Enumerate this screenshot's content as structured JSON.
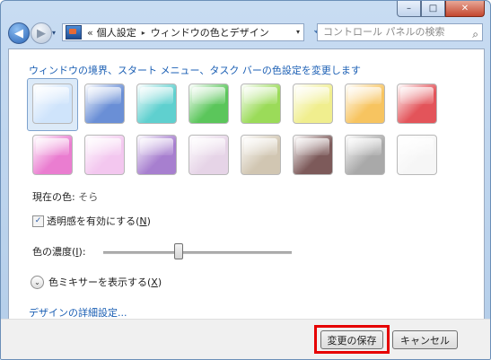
{
  "window": {
    "caption_min": "–",
    "caption_max": "□",
    "caption_close": "✕"
  },
  "nav": {
    "back_icon": "◀",
    "forward_icon": "▶",
    "history_icon": "▾",
    "address_chevron": "«",
    "crumbs": [
      "個人設定",
      "ウィンドウの色とデザイン"
    ],
    "crumb_separator": "▸",
    "address_dropdown": "▾",
    "refresh_icon": "⟲",
    "search_placeholder": "コントロール パネルの検索",
    "search_icon": "⌕"
  },
  "main": {
    "heading": "ウィンドウの境界、スタート メニュー、タスク バーの色設定を変更します",
    "swatch_colors": [
      [
        "#cfe4fb",
        "#6a8fd6",
        "#5fd0cf",
        "#5bc65b",
        "#9bdb59",
        "#f0ee8e",
        "#f7c460",
        "#e3545a"
      ],
      [
        "#ea7dd0",
        "#f3c7ef",
        "#a77fcf",
        "#e6d4e7",
        "#d1c6b2",
        "#7d5a5a",
        "#a9a9a9",
        "#f6f6f6"
      ]
    ],
    "selected_swatch": "row0-col0",
    "current_color_label": "現在の色:",
    "current_color_value": "そら",
    "transparency_check": "✓",
    "transparency_label": "透明感を有効にする(",
    "transparency_key": "N",
    "transparency_close": ")",
    "intensity_label": "色の濃度(",
    "intensity_key": "I",
    "intensity_close": "):",
    "intensity_level": 0.4,
    "mixer_icon": "⌄",
    "mixer_label": "色ミキサーを表示する(",
    "mixer_key": "X",
    "mixer_close": ")",
    "advanced_link": "デザインの詳細設定..."
  },
  "footer": {
    "save_label": "変更の保存",
    "cancel_label": "キャンセル",
    "highlight_color": "#e60000"
  }
}
